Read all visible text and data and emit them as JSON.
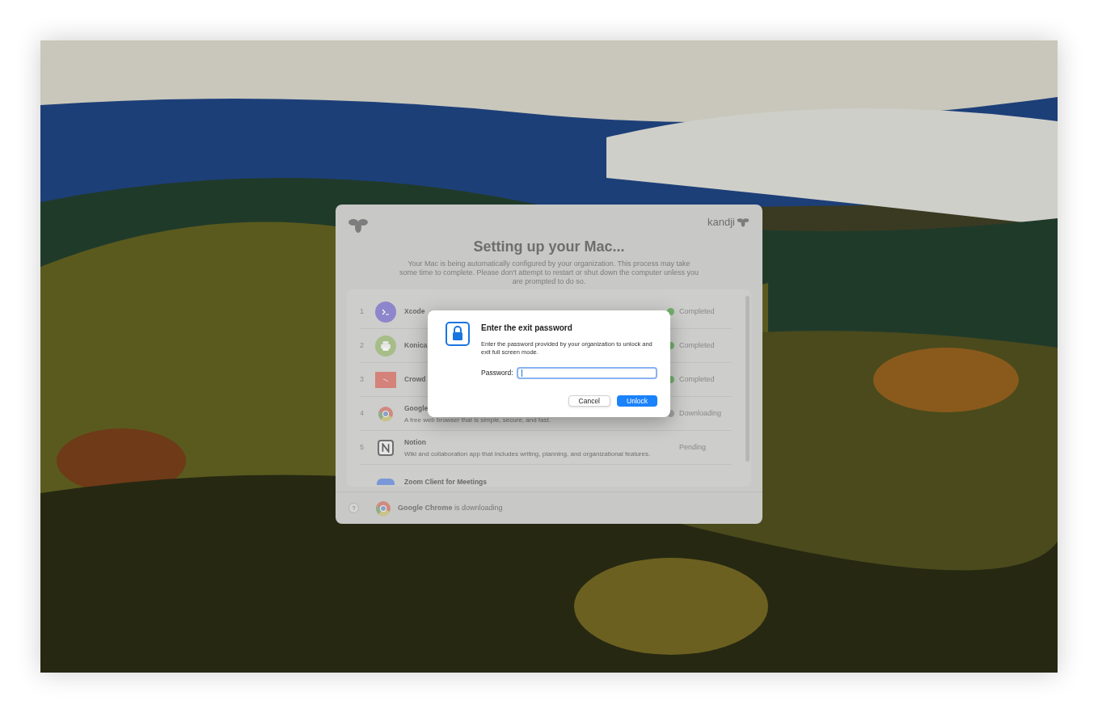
{
  "window": {
    "brand": "kandji",
    "title": "Setting up your Mac...",
    "description": "Your Mac is being automatically configured by your organization. This process may take some time to complete. Please don't attempt to restart or shut down the computer unless you are prompted to do so."
  },
  "items": [
    {
      "number": "1",
      "name": "Xcode",
      "status": "Completed",
      "kind": "completed"
    },
    {
      "number": "2",
      "name": "Konica",
      "status": "Completed",
      "kind": "completed"
    },
    {
      "number": "3",
      "name": "Crowd",
      "status": "Completed",
      "kind": "completed"
    },
    {
      "number": "4",
      "name": "Google",
      "description": "A free web browser that is simple, secure, and fast.",
      "status": "Downloading",
      "kind": "downloading"
    },
    {
      "number": "5",
      "name": "Notion",
      "description": "Wiki and collaboration app that includes writing, planning, and organizational features.",
      "status": "Pending",
      "kind": "pending"
    },
    {
      "name": "Zoom Client for Meetings",
      "kind": "cut"
    }
  ],
  "footer": {
    "help": "?",
    "app": "Google Chrome",
    "message": " is downloading"
  },
  "dialog": {
    "title": "Enter the exit password",
    "message": "Enter the password provided by your organization to unlock and exit full screen mode.",
    "label": "Password:",
    "buttons": [
      "Cancel",
      "Unlock"
    ]
  }
}
